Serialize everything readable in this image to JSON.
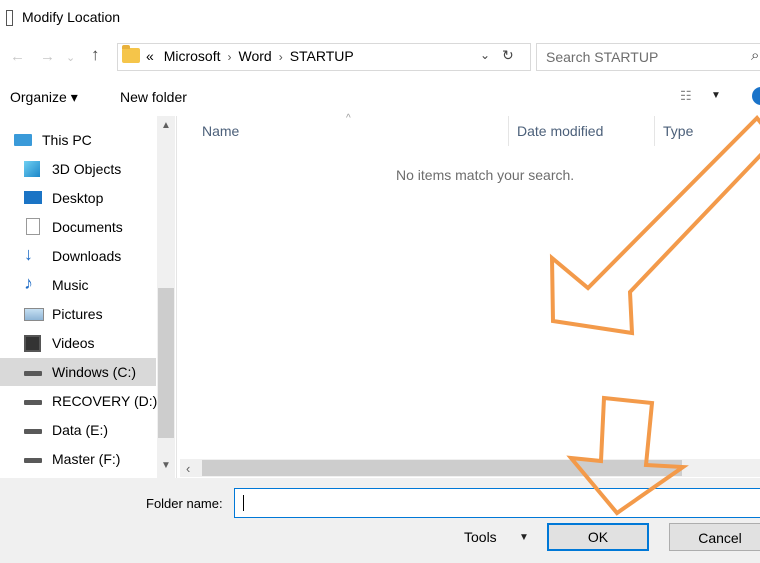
{
  "window": {
    "title": "Modify Location"
  },
  "address": {
    "overflow": "«",
    "crumbs": [
      "Microsoft",
      "Word",
      "STARTUP"
    ],
    "search_placeholder": "Search STARTUP"
  },
  "toolbar": {
    "organize": "Organize ▾",
    "new_folder": "New folder"
  },
  "sidebar": {
    "items": [
      {
        "label": "This PC",
        "icon": "pc-icon"
      },
      {
        "label": "3D Objects",
        "icon": "cube-icon"
      },
      {
        "label": "Desktop",
        "icon": "desktop-icon"
      },
      {
        "label": "Documents",
        "icon": "documents-icon"
      },
      {
        "label": "Downloads",
        "icon": "download-icon"
      },
      {
        "label": "Music",
        "icon": "music-icon"
      },
      {
        "label": "Pictures",
        "icon": "pictures-icon"
      },
      {
        "label": "Videos",
        "icon": "videos-icon"
      },
      {
        "label": "Windows (C:)",
        "icon": "drive-icon",
        "selected": true
      },
      {
        "label": "RECOVERY (D:)",
        "icon": "drive-icon"
      },
      {
        "label": "Data (E:)",
        "icon": "drive-icon"
      },
      {
        "label": "Master (F:)",
        "icon": "drive-icon"
      }
    ]
  },
  "columns": {
    "name": "Name",
    "date_modified": "Date modified",
    "type": "Type"
  },
  "content": {
    "empty_message": "No items match your search."
  },
  "footer": {
    "folder_name_label": "Folder name:",
    "folder_name_value": "",
    "tools": "Tools",
    "ok": "OK",
    "cancel": "Cancel"
  },
  "colors": {
    "annotation_arrow": "#f39a4a",
    "accent": "#0078d7",
    "selection": "#d9d9d9"
  }
}
